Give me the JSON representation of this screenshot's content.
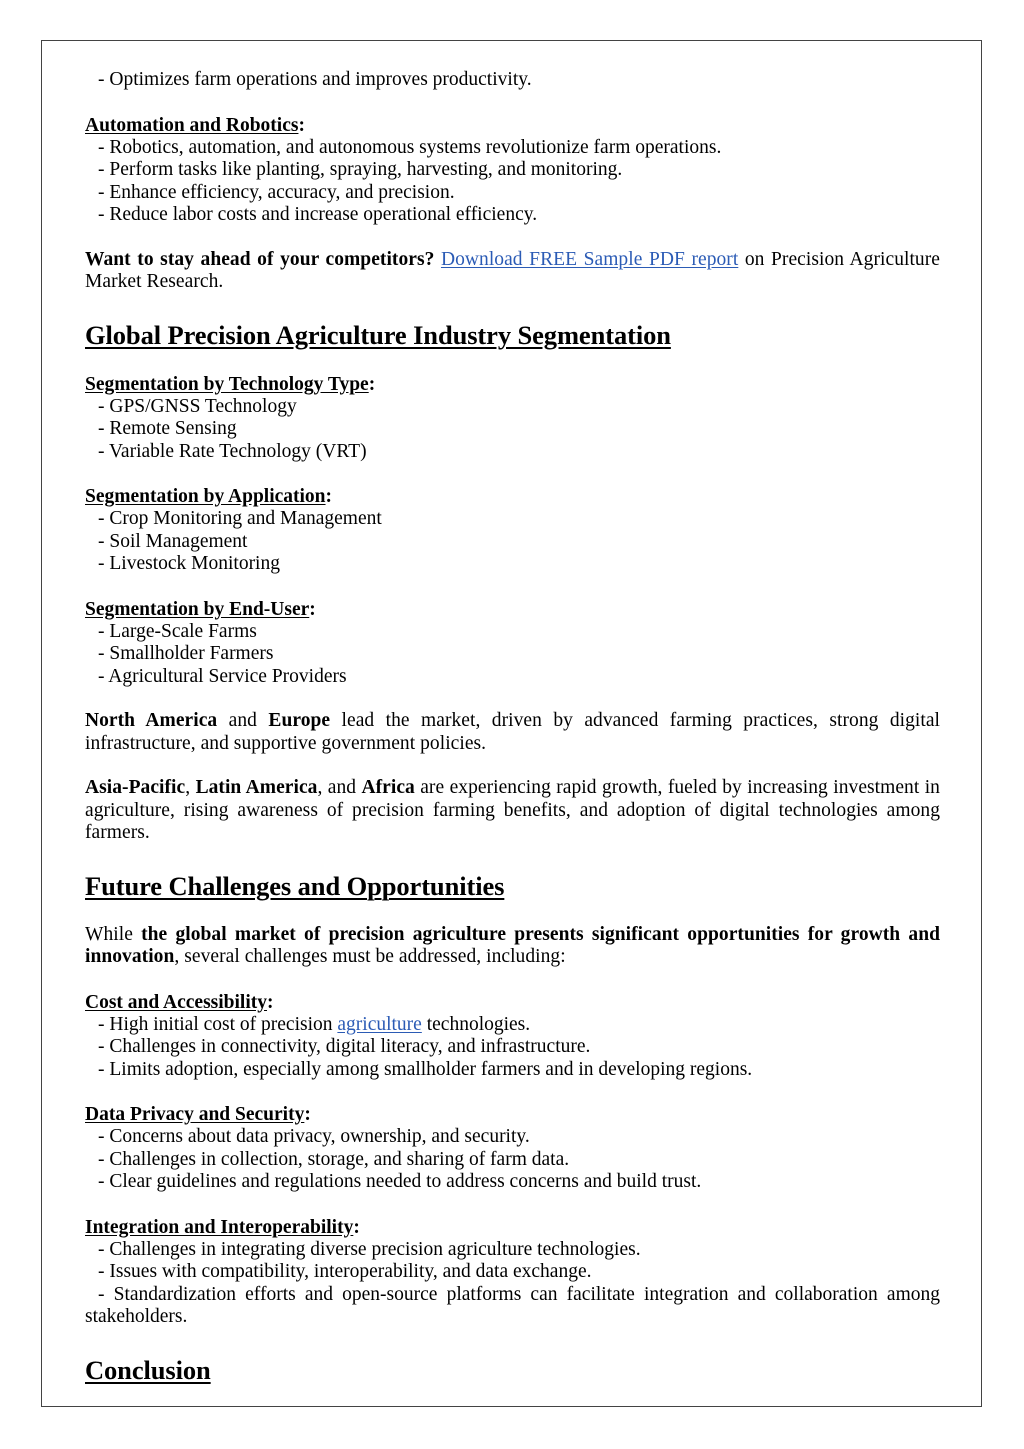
{
  "document": {
    "blocks": [
      {
        "id": "b1",
        "type": "bullet",
        "text": "- Optimizes farm operations and improves productivity."
      },
      {
        "id": "b2",
        "type": "label",
        "text": "Automation and Robotics",
        "suffix": ":"
      },
      {
        "id": "b3",
        "type": "bullet",
        "text": "- Robotics, automation, and autonomous systems revolutionize farm operations."
      },
      {
        "id": "b4",
        "type": "bullet",
        "text": "- Perform tasks like planting, spraying, harvesting, and monitoring."
      },
      {
        "id": "b5",
        "type": "bullet",
        "text": "- Enhance efficiency, accuracy, and precision."
      },
      {
        "id": "b6",
        "type": "bullet",
        "text": "- Reduce labor costs and increase operational efficiency."
      },
      {
        "id": "b7",
        "type": "cta-paragraph",
        "lead": "Want to stay ahead of your competitors?",
        "link_text": "Download FREE Sample PDF report",
        "tail": " on Precision Agriculture Market Research."
      },
      {
        "id": "b8",
        "type": "heading",
        "text": "Global Precision Agriculture Industry Segmentation"
      },
      {
        "id": "b9",
        "type": "label",
        "text": "Segmentation by Technology Type",
        "suffix": ":"
      },
      {
        "id": "b10",
        "type": "bullet",
        "text": "- GPS/GNSS Technology"
      },
      {
        "id": "b11",
        "type": "bullet",
        "text": "- Remote Sensing"
      },
      {
        "id": "b12",
        "type": "bullet",
        "text": "- Variable Rate Technology (VRT)"
      },
      {
        "id": "b13",
        "type": "label",
        "text": "Segmentation by Application",
        "suffix": ":"
      },
      {
        "id": "b14",
        "type": "bullet",
        "text": "- Crop Monitoring and Management"
      },
      {
        "id": "b15",
        "type": "bullet",
        "text": "- Soil Management"
      },
      {
        "id": "b16",
        "type": "bullet",
        "text": "- Livestock Monitoring"
      },
      {
        "id": "b17",
        "type": "label",
        "text": "Segmentation by End-User",
        "suffix": ":"
      },
      {
        "id": "b18",
        "type": "bullet",
        "text": "- Large-Scale Farms"
      },
      {
        "id": "b19",
        "type": "bullet",
        "text": "- Smallholder Farmers"
      },
      {
        "id": "b20",
        "type": "bullet",
        "text": "- Agricultural Service Providers"
      },
      {
        "id": "b21",
        "type": "region-paragraph-1"
      },
      {
        "id": "b22",
        "type": "region-paragraph-2"
      },
      {
        "id": "b23",
        "type": "heading",
        "text": "Future Challenges and Opportunities"
      },
      {
        "id": "b24",
        "type": "while-paragraph"
      },
      {
        "id": "b25",
        "type": "label",
        "text": "Cost and Accessibility",
        "suffix": ":"
      },
      {
        "id": "b26",
        "type": "bullet-link"
      },
      {
        "id": "b27",
        "type": "bullet",
        "text": "- Challenges in connectivity, digital literacy, and infrastructure."
      },
      {
        "id": "b28",
        "type": "bullet",
        "text": "- Limits adoption, especially among smallholder farmers and in developing regions."
      },
      {
        "id": "b29",
        "type": "label",
        "text": "Data Privacy and Security",
        "suffix": ":"
      },
      {
        "id": "b30",
        "type": "bullet",
        "text": "- Concerns about data privacy, ownership, and security."
      },
      {
        "id": "b31",
        "type": "bullet",
        "text": "- Challenges in collection, storage, and sharing of farm data."
      },
      {
        "id": "b32",
        "type": "bullet",
        "text": "- Clear guidelines and regulations needed to address concerns and build trust."
      },
      {
        "id": "b33",
        "type": "label",
        "text": "Integration and Interoperability",
        "suffix": ":"
      },
      {
        "id": "b34",
        "type": "bullet",
        "text": "- Challenges in integrating diverse precision agriculture technologies."
      },
      {
        "id": "b35",
        "type": "bullet",
        "text": "- Issues with compatibility, interoperability, and data exchange."
      },
      {
        "id": "b36",
        "type": "bullet",
        "text": "- Standardization efforts and open-source platforms can facilitate integration and collaboration among stakeholders."
      },
      {
        "id": "b37",
        "type": "heading",
        "text": "Conclusion"
      }
    ]
  },
  "bullets": {
    "optimizes": "- Optimizes farm operations and improves productivity.",
    "robotics": "- Robotics, automation, and autonomous systems revolutionize farm operations.",
    "perform_tasks": "- Perform tasks like planting, spraying, harvesting, and monitoring.",
    "enhance": "- Enhance efficiency, accuracy, and precision.",
    "reduce_labor": "- Reduce labor costs and increase operational efficiency.",
    "gps": "- GPS/GNSS Technology",
    "remote_sensing": "- Remote Sensing",
    "vrt": "- Variable Rate Technology (VRT)",
    "crop_monitoring": "- Crop Monitoring and Management",
    "soil_management": "- Soil Management",
    "livestock_monitoring": "- Livestock Monitoring",
    "large_scale": "- Large-Scale Farms",
    "smallholder": "- Smallholder Farmers",
    "service_providers": "- Agricultural Service Providers",
    "high_cost_pre": "- High initial cost of precision ",
    "high_cost_link": "agriculture",
    "high_cost_post": " technologies.",
    "connectivity": "- Challenges in connectivity, digital literacy, and infrastructure.",
    "limits_adoption": "- Limits adoption, especially among smallholder farmers and in developing regions.",
    "concerns_privacy": "- Concerns about data privacy, ownership, and security.",
    "collection_storage": "- Challenges in collection, storage, and sharing of farm data.",
    "clear_guidelines": "- Clear guidelines and regulations needed to address concerns and build trust.",
    "integrating_diverse": "- Challenges in integrating diverse precision agriculture technologies.",
    "compatibility": "- Issues with compatibility, interoperability, and data exchange.",
    "standardization": "- Standardization efforts and open-source platforms can facilitate integration and collaboration among stakeholders."
  },
  "labels": {
    "automation_robotics": "Automation and Robotics",
    "seg_technology": "Segmentation by Technology Type",
    "seg_application": "Segmentation by Application",
    "seg_enduser": "Segmentation by End-User",
    "cost_accessibility": "Cost and Accessibility",
    "data_privacy": "Data Privacy and Security",
    "integration_interop": "Integration and Interoperability",
    "colon": ":"
  },
  "headings": {
    "segmentation": "Global Precision Agriculture Industry Segmentation",
    "future_challenges": "Future Challenges and Opportunities",
    "conclusion": "Conclusion"
  },
  "cta": {
    "lead": "Want to stay ahead of your competitors?",
    "link_text": "Download FREE Sample PDF report",
    "tail": " on Precision Agriculture Market Research."
  },
  "paragraphs": {
    "regions_1": {
      "b1": "North America",
      "mid1": " and ",
      "b2": "Europe",
      "tail": " lead the market, driven by advanced farming practices, strong digital infrastructure, and supportive government policies."
    },
    "regions_2": {
      "b1": "Asia-Pacific",
      "sep1": ", ",
      "b2": "Latin America",
      "sep2": ", and ",
      "b3": "Africa",
      "tail": " are experiencing rapid growth, fueled by increasing investment in agriculture, rising awareness of precision farming benefits, and adoption of digital technologies among farmers."
    },
    "while": {
      "lead": "While ",
      "bold": "the global market of precision agriculture presents significant opportunities for growth and innovation",
      "tail": ", several challenges must be addressed, including:"
    }
  },
  "colors": {
    "link": "#2b5bb5",
    "text": "#000000",
    "page_border": "#434343",
    "background": "#ffffff"
  }
}
